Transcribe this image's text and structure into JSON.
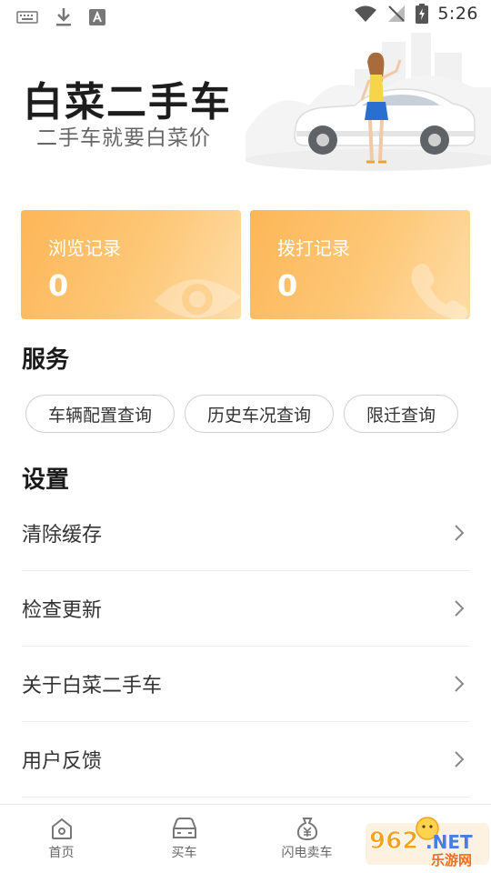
{
  "status_bar": {
    "time": "5:26",
    "icons": [
      "keyboard-icon",
      "download-icon",
      "font-icon",
      "wifi-icon",
      "no-sim-icon",
      "battery-charging-icon"
    ]
  },
  "header": {
    "title": "白菜二手车",
    "subtitle": "二手车就要白菜价"
  },
  "stats": [
    {
      "label": "浏览记录",
      "value": "0",
      "icon": "eye-icon"
    },
    {
      "label": "拨打记录",
      "value": "0",
      "icon": "phone-icon"
    }
  ],
  "services": {
    "title": "服务",
    "items": [
      "车辆配置查询",
      "历史车况查询",
      "限迁查询"
    ]
  },
  "settings": {
    "title": "设置",
    "items": [
      "清除缓存",
      "检查更新",
      "关于白菜二手车",
      "用户反馈"
    ]
  },
  "bottom_nav": {
    "items": [
      {
        "label": "首页",
        "icon": "home-icon"
      },
      {
        "label": "买车",
        "icon": "car-icon"
      },
      {
        "label": "闪电卖车",
        "icon": "money-bag-icon"
      }
    ]
  },
  "watermark": {
    "text": "962.NET",
    "subtext": "乐游网"
  },
  "colors": {
    "card_gradient_start": "#fdb657",
    "card_gradient_end": "#fedda8",
    "text_primary": "#1d1d1d",
    "text_secondary": "#666666"
  }
}
